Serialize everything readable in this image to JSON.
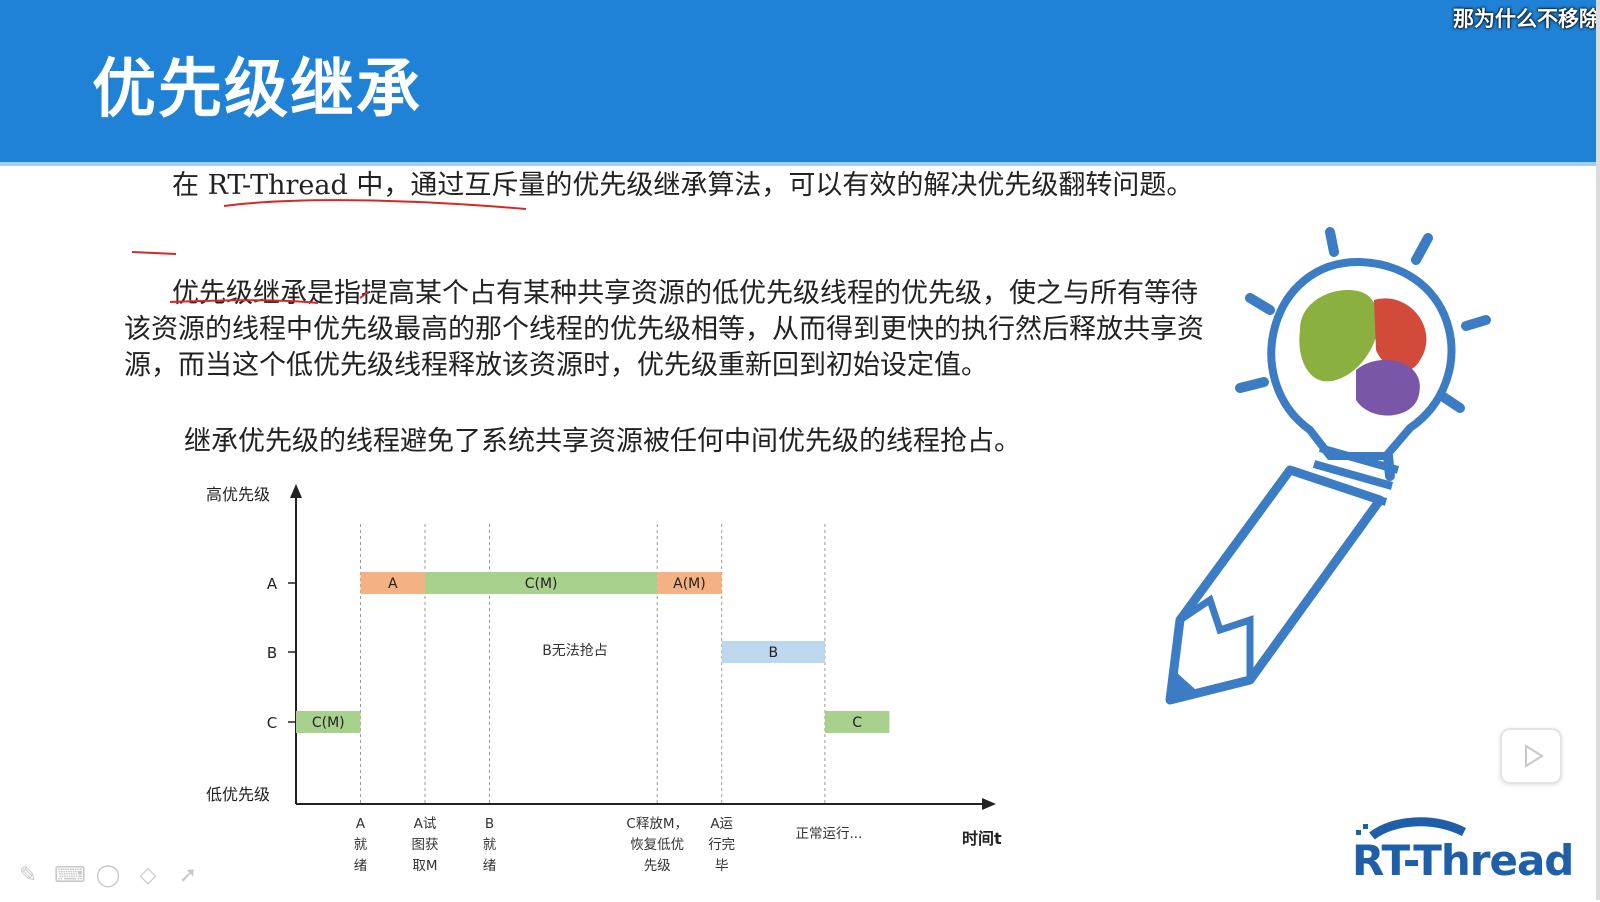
{
  "slide": {
    "title": "优先级继承",
    "overlay_caption": "那为什么不移除"
  },
  "content": {
    "paragraph1": "在 RT-Thread 中，通过互斥量的优先级继承算法，可以有效的解决优先级翻转问题。",
    "paragraph2": "优先级继承是指提高某个占有某种共享资源的低优先级线程的优先级，使之与所有等待该资源的线程中优先级最高的那个线程的优先级相等，从而得到更快的执行然后释放共享资源，而当这个低优先级线程释放该资源时，优先级重新回到初始设定值。",
    "paragraph3": "继承优先级的线程避免了系统共享资源被任何中间优先级的线程抢占。"
  },
  "chart_data": {
    "type": "timeline",
    "y_axis_top_label": "高优先级",
    "y_axis_bottom_label": "低优先级",
    "x_axis_label": "时间t",
    "rows": [
      "A",
      "B",
      "C"
    ],
    "bars": [
      {
        "row": "C",
        "label": "C(M)",
        "start": 0,
        "end": 1,
        "color": "#a9d18e"
      },
      {
        "row": "A",
        "label": "A",
        "start": 1,
        "end": 2,
        "color": "#f4b183"
      },
      {
        "row": "A",
        "label": "C(M)",
        "start": 2,
        "end": 5.6,
        "color": "#a9d18e"
      },
      {
        "row": "A",
        "label": "A(M)",
        "start": 5.6,
        "end": 6.6,
        "color": "#f4b183"
      },
      {
        "row": "B",
        "label": "B",
        "start": 6.6,
        "end": 8.2,
        "color": "#bdd7ee"
      },
      {
        "row": "C",
        "label": "C",
        "start": 8.2,
        "end": 9.2,
        "color": "#a9d18e"
      }
    ],
    "events": [
      {
        "t": 1,
        "label": [
          "A",
          "就",
          "绪"
        ]
      },
      {
        "t": 2,
        "label": [
          "A试",
          "图获",
          "取M"
        ]
      },
      {
        "t": 3,
        "label": [
          "B",
          "就",
          "绪"
        ]
      },
      {
        "t": 5.6,
        "label": [
          "C释放M，",
          "恢复低优",
          "先级"
        ]
      },
      {
        "t": 6.6,
        "label": [
          "A运",
          "行完",
          "毕"
        ]
      },
      {
        "t": 8.2,
        "label": [
          "正常运行..."
        ]
      }
    ],
    "annotation": "B无法抢占"
  },
  "logo": {
    "text": "RT-Thread"
  },
  "toolbar": {
    "icons": [
      "pen-icon",
      "keyboard-icon",
      "lasso-icon",
      "eraser-icon",
      "pointer-icon"
    ]
  },
  "colors": {
    "header": "#1f82d6",
    "logo": "#1f5ea8",
    "bulb_outline": "#3c7cc4"
  }
}
